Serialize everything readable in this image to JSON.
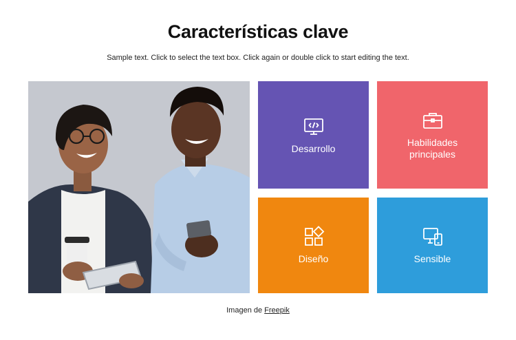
{
  "header": {
    "title": "Características clave",
    "subtitle": "Sample text. Click to select the text box. Click again or double click to start editing the text."
  },
  "tiles": [
    {
      "label": "Desarrollo",
      "icon": "code-window-icon",
      "color": "#6554b3"
    },
    {
      "label": "Habilidades principales",
      "icon": "briefcase-icon",
      "color": "#f0656b"
    },
    {
      "label": "Diseño",
      "icon": "design-blocks-icon",
      "color": "#f0870f"
    },
    {
      "label": "Sensible",
      "icon": "devices-icon",
      "color": "#2e9ddb"
    }
  ],
  "credit": {
    "prefix": "Imagen de",
    "link": "Freepik"
  }
}
